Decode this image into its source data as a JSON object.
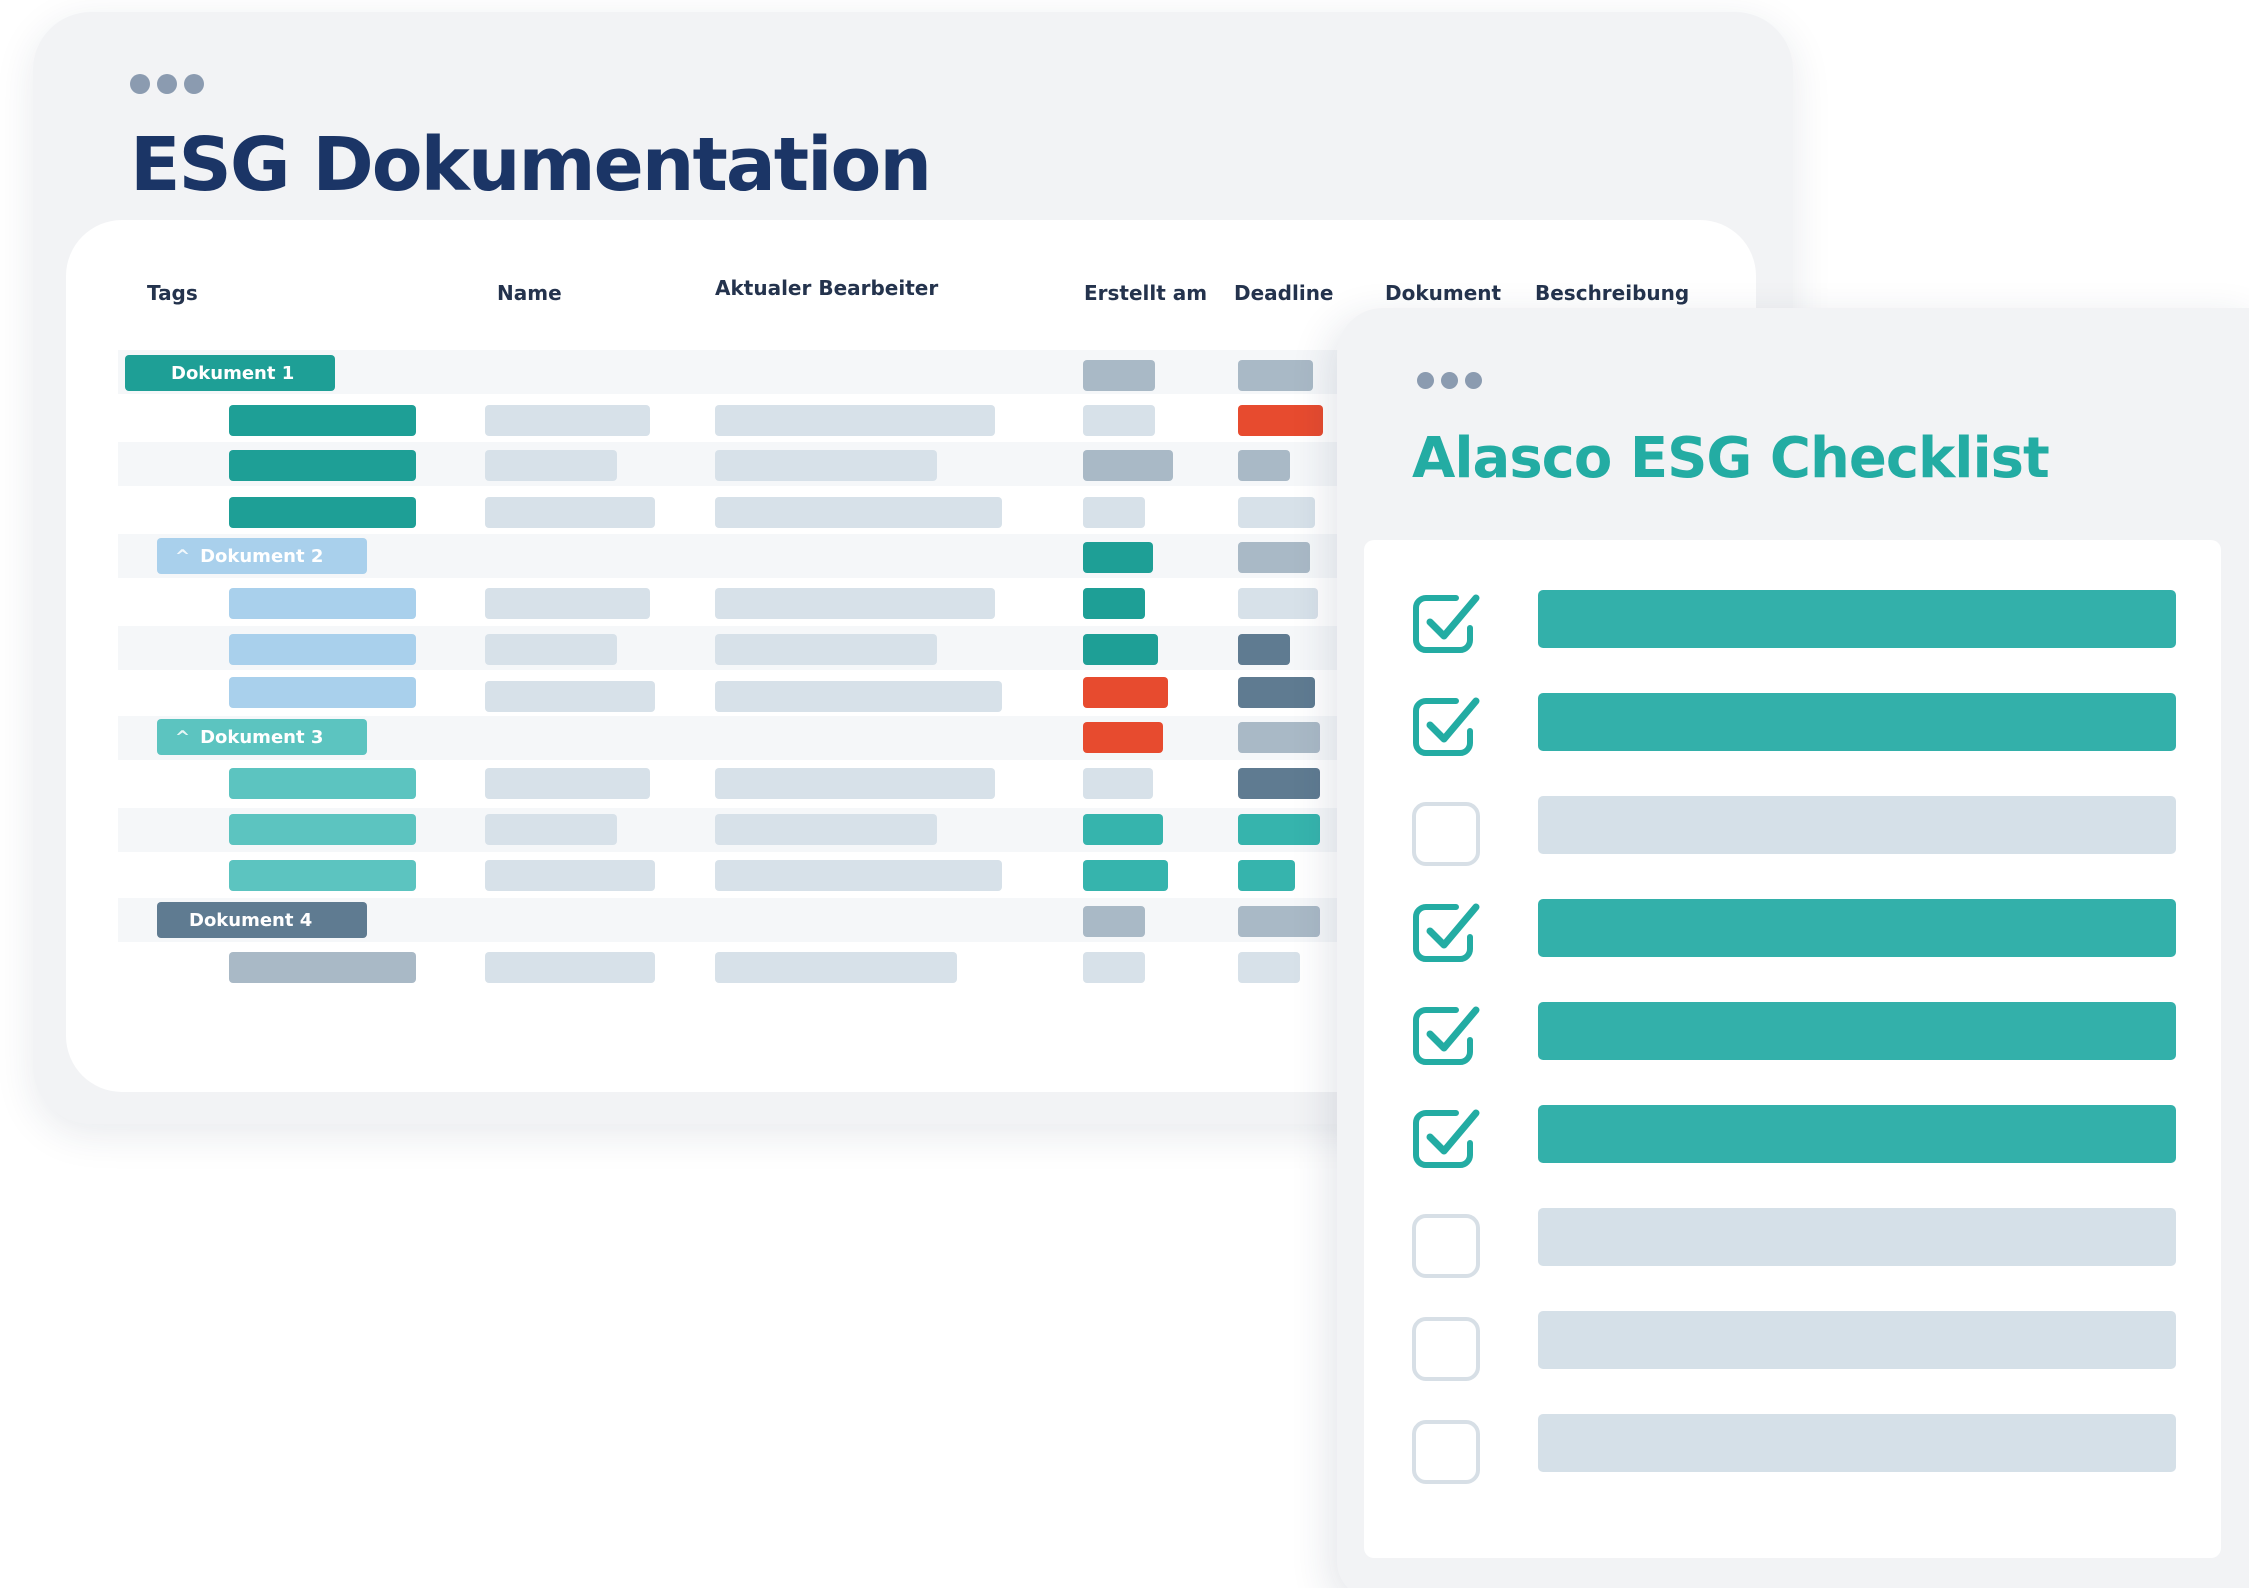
{
  "documentation_window": {
    "title": "ESG Dokumentation",
    "columns": [
      "Tags",
      "Name",
      "Aktualer Bearbeiter",
      "Erstellt am",
      "Deadline",
      "Dokument",
      "Beschreibung"
    ],
    "groups": [
      {
        "label": "Dokument 1",
        "collapsible": false
      },
      {
        "label": "Dokument 2",
        "collapsible": true
      },
      {
        "label": "Dokument 3",
        "collapsible": true
      },
      {
        "label": "Dokument 4",
        "collapsible": false
      }
    ],
    "colors": {
      "title": "#1b3566",
      "teal_dark": "#1e9f96",
      "teal": "#36b4ad",
      "teal_light": "#5cc4c0",
      "blue_light": "#a9d0ec",
      "slate": "#5f7b91",
      "placeholder": "#d7e1e9",
      "placeholder_mid": "#a9b9c6",
      "alert": "#e74b2f"
    }
  },
  "checklist_window": {
    "title": "Alasco ESG Checklist",
    "items_checked": [
      true,
      true,
      false,
      true,
      true,
      true,
      false,
      false,
      false
    ],
    "colors": {
      "title": "#23aca3",
      "checked_bar": "#33b0aa",
      "unchecked_bar": "#d5e0e8",
      "checkbox_border": "#d7dfe6"
    }
  }
}
